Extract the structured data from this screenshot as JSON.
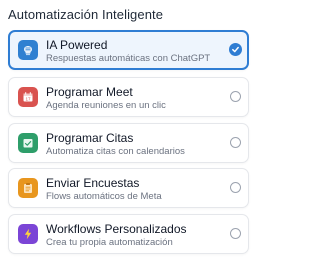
{
  "section": {
    "title": "Automatización Inteligente"
  },
  "options": [
    {
      "title": "IA Powered",
      "subtitle": "Respuestas automáticas con ChatGPT",
      "icon": "brain-icon",
      "icon_color": "#2f80d1",
      "selected": true
    },
    {
      "title": "Programar Meet",
      "subtitle": "Agenda reuniones en un clic",
      "icon": "calendar-icon",
      "icon_color": "#d9534f",
      "selected": false
    },
    {
      "title": "Programar Citas",
      "subtitle": "Automatiza citas con calendarios",
      "icon": "calendar-check-icon",
      "icon_color": "#2e9e6a",
      "selected": false
    },
    {
      "title": "Enviar Encuestas",
      "subtitle": "Flows automáticos de Meta",
      "icon": "clipboard-icon",
      "icon_color": "#e8961e",
      "selected": false
    },
    {
      "title": "Workflows Personalizados",
      "subtitle": "Crea tu propia automatización",
      "icon": "lightning-icon",
      "icon_color": "#7b45d6",
      "selected": false
    }
  ],
  "colors": {
    "accent": "#2f7dd3",
    "selected_bg": "#eef5fd"
  }
}
